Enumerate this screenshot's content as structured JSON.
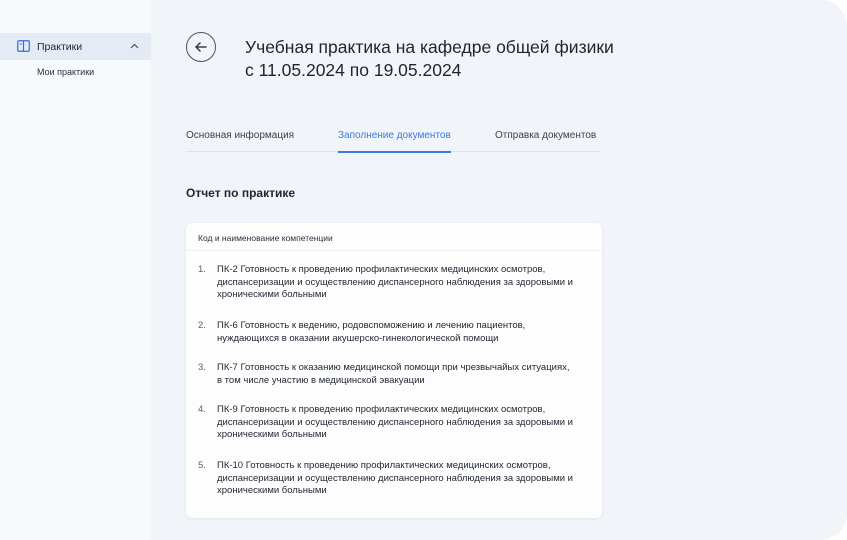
{
  "sidebar": {
    "group_label": "Практики",
    "sub_items": [
      "Мои практики"
    ]
  },
  "header": {
    "title_line1": "Учебная практика на кафедре общей физики",
    "title_line2": "с  11.05.2024 по 19.05.2024"
  },
  "tabs": [
    {
      "label": "Основная информация",
      "active": false
    },
    {
      "label": "Заполнение документов",
      "active": true
    },
    {
      "label": "Отправка документов",
      "active": false
    }
  ],
  "section_title": "Отчет по практике",
  "card": {
    "header": "Код и наименование компетенции",
    "items": [
      {
        "num": "1.",
        "text": "ПК-2 Готовность к проведению профилактических медицинских осмотров, диспансеризации и осуществлению диспансерного наблюдения за здоровыми и хроническими больными"
      },
      {
        "num": "2.",
        "text": "ПК-6 Готовность к ведению, родовспоможению и лечению пациентов, нуждающихся в оказании акушерско-гинекологической помощи"
      },
      {
        "num": "3.",
        "text": "ПК-7 Готовность к оказанию медицинской помощи при чрезвычайых ситуациях, в том числе участию в медицинской эвакуации"
      },
      {
        "num": "4.",
        "text": "ПК-9 Готовность к проведению профилактических медицинских осмотров, диспансеризации и осуществлению диспансерного наблюдения за здоровыми и хроническими больными"
      },
      {
        "num": "5.",
        "text": "ПК-10 Готовность к проведению профилактических медицинских осмотров, диспансеризации и осуществлению диспансерного наблюдения за здоровыми и хроническими больными"
      }
    ]
  },
  "colors": {
    "accent": "#3b7ae0",
    "sidebar_bg": "#f7f9fc",
    "sidebar_active_bg": "#e4ebf5",
    "main_bg": "#f1f4f9"
  },
  "icons": {
    "sidebar_group": "book-icon",
    "sidebar_toggle": "chevron-up-icon",
    "back": "arrow-left-icon"
  }
}
